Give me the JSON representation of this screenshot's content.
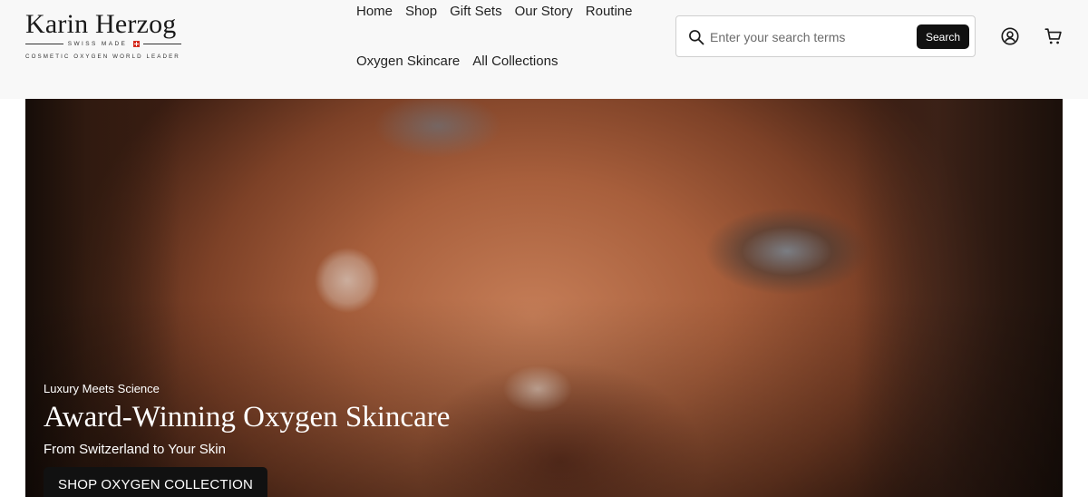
{
  "header": {
    "logo": {
      "brand": "Karin Herzog",
      "swiss_made": "SWISS MADE",
      "tagline": "COSMETIC OXYGEN WORLD LEADER"
    },
    "nav": {
      "row1": [
        "Home",
        "Shop",
        "Gift Sets",
        "Our Story",
        "Routine"
      ],
      "row2": [
        "Oxygen Skincare",
        "All Collections"
      ]
    },
    "search": {
      "placeholder": "Enter your search terms",
      "value": "",
      "button_label": "Search"
    },
    "icons": [
      "search-icon",
      "account-icon",
      "cart-icon"
    ]
  },
  "hero": {
    "eyebrow": "Luxury Meets Science",
    "title": "Award-Winning Oxygen Skincare",
    "subtitle": "From Switzerland to Your Skin",
    "cta_label": "SHOP OXYGEN COLLECTION"
  },
  "colors": {
    "header_bg": "#f8f8f8",
    "button_bg": "#111111",
    "button_text": "#ffffff",
    "flag_red": "#d52b1e"
  }
}
